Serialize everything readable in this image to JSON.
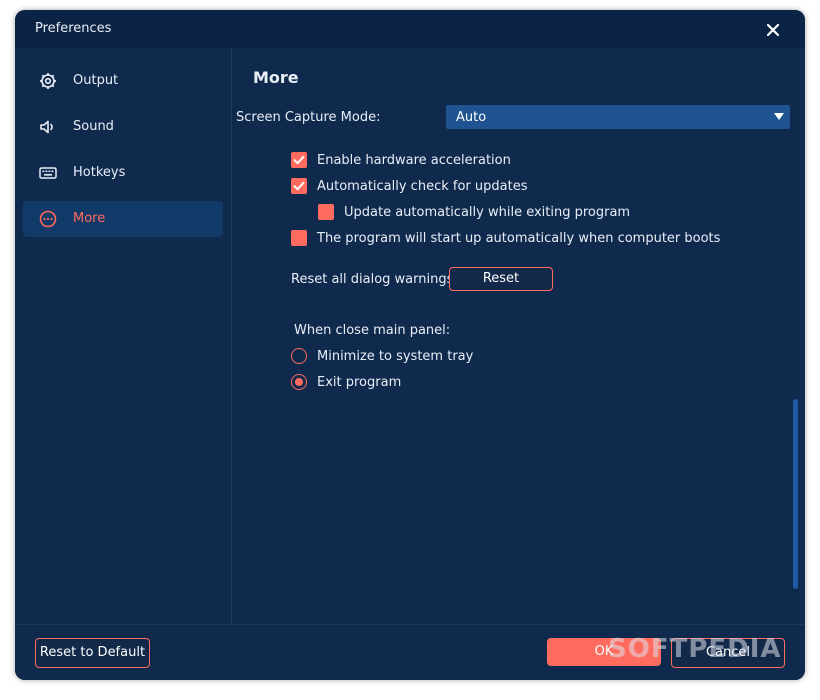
{
  "window": {
    "title": "Preferences"
  },
  "sidebar": {
    "items": [
      {
        "label": "Output",
        "icon": "gear-icon"
      },
      {
        "label": "Sound",
        "icon": "speaker-icon"
      },
      {
        "label": "Hotkeys",
        "icon": "keyboard-icon"
      },
      {
        "label": "More",
        "icon": "more-circle-icon",
        "active": true
      }
    ]
  },
  "content": {
    "section_title": "More",
    "screen_capture": {
      "label": "Screen Capture Mode:",
      "value": "Auto"
    },
    "checkboxes": [
      {
        "label": "Enable hardware acceleration",
        "checked": true
      },
      {
        "label": "Automatically check for updates",
        "checked": true
      },
      {
        "label": "Update automatically while exiting program",
        "checked": false
      },
      {
        "label": "The program will start up automatically when computer boots",
        "checked": false
      }
    ],
    "reset_warnings": {
      "label": "Reset all dialog warnings:",
      "button": "Reset"
    },
    "close_panel": {
      "label": "When close main panel:",
      "options": [
        {
          "label": "Minimize to system tray",
          "selected": false
        },
        {
          "label": "Exit program",
          "selected": true
        }
      ]
    }
  },
  "footer": {
    "reset_default": "Reset to Default",
    "ok": "OK",
    "cancel": "Cancel"
  },
  "watermark": "SOFTPEDIA",
  "colors": {
    "background": "#0f2a4d",
    "accent": "#ff6b5f",
    "select": "#1f5391",
    "active_nav": "#123a68"
  }
}
